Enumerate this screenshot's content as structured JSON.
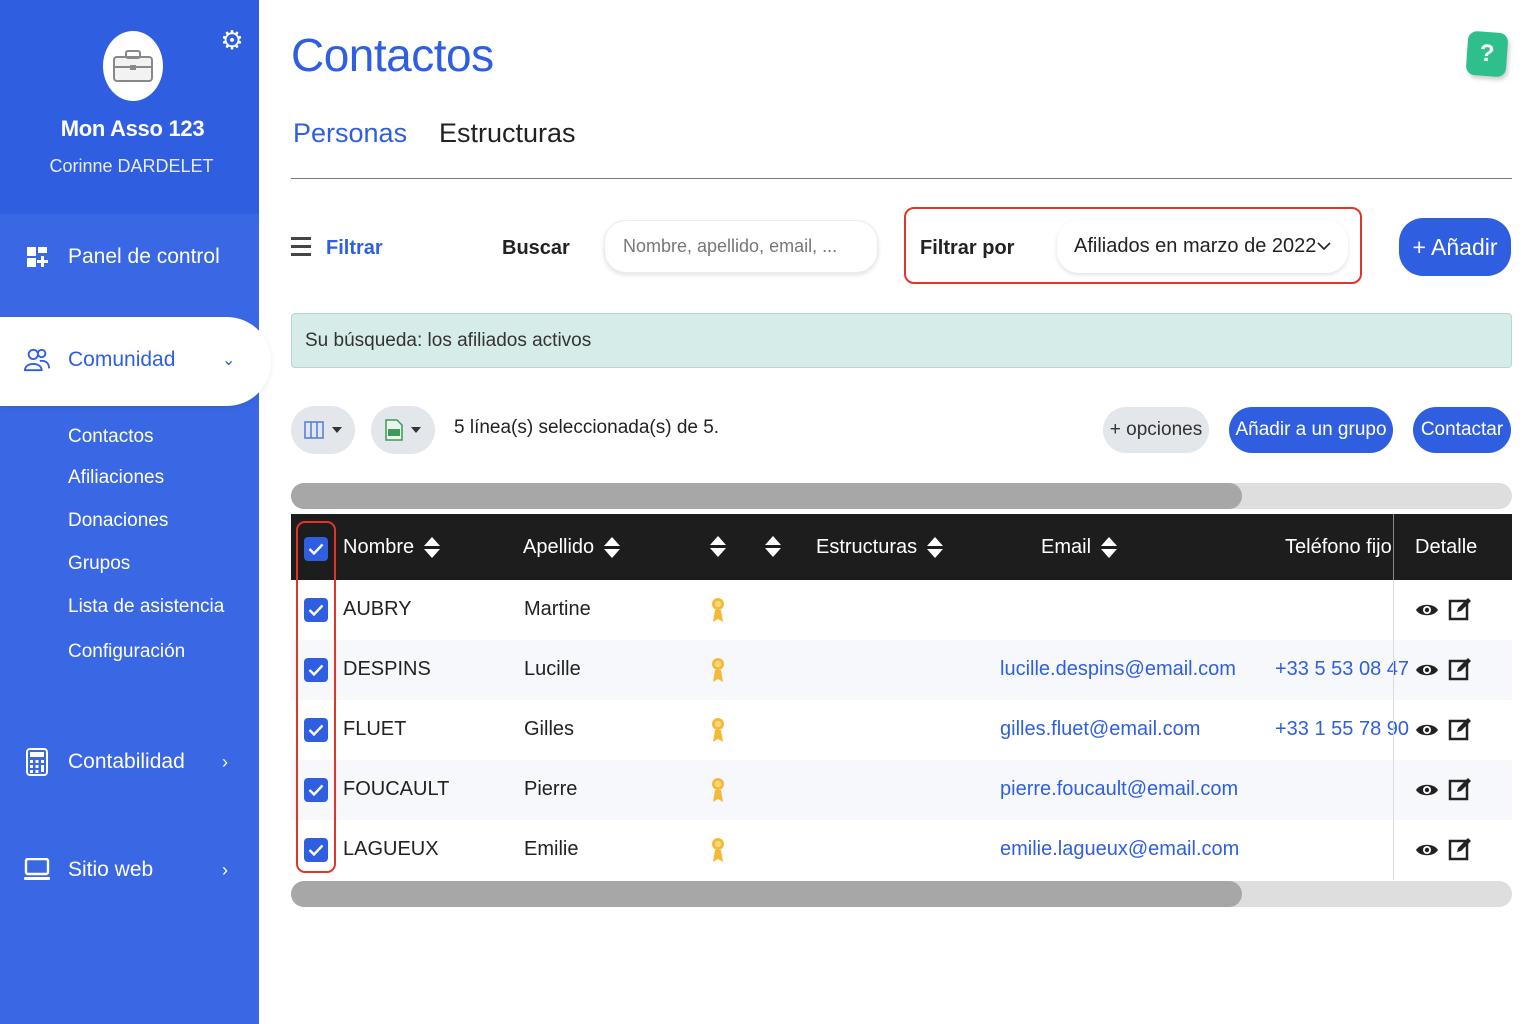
{
  "sidebar": {
    "org_name": "Mon Asso 123",
    "user_name": "Corinne DARDELET",
    "nav": {
      "dashboard": "Panel de control",
      "community": "Comunidad",
      "accounting": "Contabilidad",
      "website": "Sitio web"
    },
    "community_sub": [
      "Contactos",
      "Afiliaciones",
      "Donaciones",
      "Grupos",
      "Lista de asistencia",
      "Configuración"
    ]
  },
  "header": {
    "title": "Contactos",
    "help_label": "?"
  },
  "tabs": [
    "Personas",
    "Estructuras"
  ],
  "toolbar": {
    "filter_label": "Filtrar",
    "search_label": "Buscar",
    "search_placeholder": "Nombre, apellido, email, ...",
    "search_value": "",
    "filter_by_label": "Filtrar por",
    "filter_by_value": "Afiliados en marzo de 2022",
    "add_label": "+ Añadir"
  },
  "info_bar": "Su búsqueda: los afiliados activos",
  "actions": {
    "selection_text": "5 línea(s) seleccionada(s) de 5.",
    "options_label": "+ opciones",
    "add_group_label": "Añadir a un grupo",
    "contact_label": "Contactar"
  },
  "table": {
    "headers": {
      "nombre": "Nombre",
      "apellido": "Apellido",
      "estructuras": "Estructuras",
      "email": "Email",
      "telefono": "Teléfono fijo",
      "detalle": "Detalle"
    },
    "rows": [
      {
        "nombre": "AUBRY",
        "apellido": "Martine",
        "email": "",
        "telefono": ""
      },
      {
        "nombre": "DESPINS",
        "apellido": "Lucille",
        "email": "lucille.despins@email.com",
        "telefono": "+33 5 53 08 47"
      },
      {
        "nombre": "FLUET",
        "apellido": "Gilles",
        "email": "gilles.fluet@email.com",
        "telefono": "+33 1 55 78 90"
      },
      {
        "nombre": "FOUCAULT",
        "apellido": "Pierre",
        "email": "pierre.foucault@email.com",
        "telefono": ""
      },
      {
        "nombre": "LAGUEUX",
        "apellido": "Emilie",
        "email": "emilie.lagueux@email.com",
        "telefono": ""
      }
    ]
  },
  "colors": {
    "primary": "#2f5fe0",
    "sidebar": "#3a68e4",
    "highlight": "#e0362a",
    "info_bg": "#d6ece9",
    "help": "#2fbf8c"
  },
  "icons": [
    "briefcase-icon",
    "gear-icon",
    "dashboard-icon",
    "community-icon",
    "calculator-icon",
    "monitor-icon",
    "chevron-down-icon",
    "chevron-right-icon",
    "menu-icon",
    "columns-icon",
    "excel-export-icon",
    "sort-icon",
    "medal-icon",
    "eye-icon",
    "edit-icon",
    "check-icon"
  ]
}
